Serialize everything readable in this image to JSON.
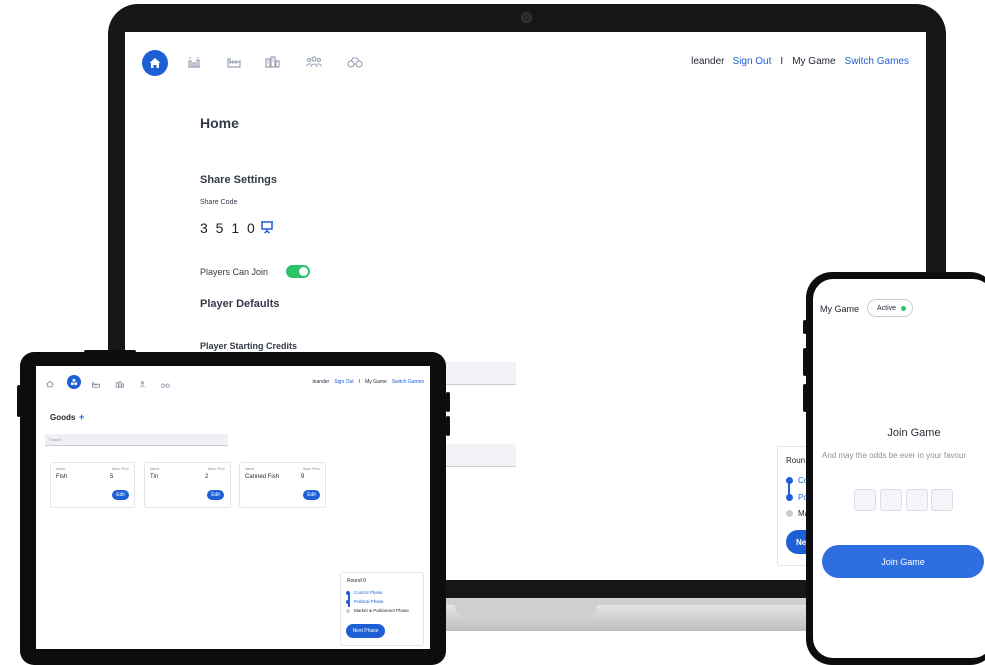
{
  "laptop": {
    "nav": {
      "user": "leander",
      "sign_out": "Sign Out",
      "separator": "I",
      "my_game": "My Game",
      "switch_games": "Switch Games"
    },
    "page_title": "Home",
    "share_settings": {
      "heading": "Share Settings",
      "code_label": "Share Code",
      "code": "3 5 1 0"
    },
    "players_can_join": "Players Can Join",
    "player_defaults": "Player Defaults",
    "player_starting_credits": "Player Starting Credits",
    "round_panel": {
      "label": "Roun",
      "item1": "Co",
      "item2": "Po",
      "item3": "Ma",
      "button": "Ne"
    }
  },
  "tablet": {
    "nav": {
      "user": "leander",
      "sign_out": "Sign Out",
      "separator": "I",
      "my_game": "My Game",
      "switch_games": "Switch Games"
    },
    "goods_title": "Goods",
    "add_symbol": "+",
    "search_placeholder": "Search",
    "cards": [
      {
        "name_label": "Name",
        "price_label": "Base Price",
        "name": "Fish",
        "price": "5",
        "button": "Edit"
      },
      {
        "name_label": "Name",
        "price_label": "Base Price",
        "name": "Tin",
        "price": "2",
        "button": "Edit"
      },
      {
        "name_label": "Name",
        "price_label": "Base Price",
        "name": "Canned Fish",
        "price": "9",
        "button": "Edit"
      }
    ],
    "round_panel": {
      "label": "Round 0",
      "phases": [
        "Control Phase",
        "Political Phase",
        "Market & Parliament Phase"
      ],
      "button": "Next Phase"
    }
  },
  "phone": {
    "my_game": "My Game",
    "status": "Active",
    "join_title": "Join Game",
    "subtitle": "And may the odds be ever in your favour",
    "button": "Join Game"
  },
  "colors": {
    "accent": "#1f5fd6",
    "toggle_on": "#2bc46a",
    "button": "#2f6ee0"
  }
}
